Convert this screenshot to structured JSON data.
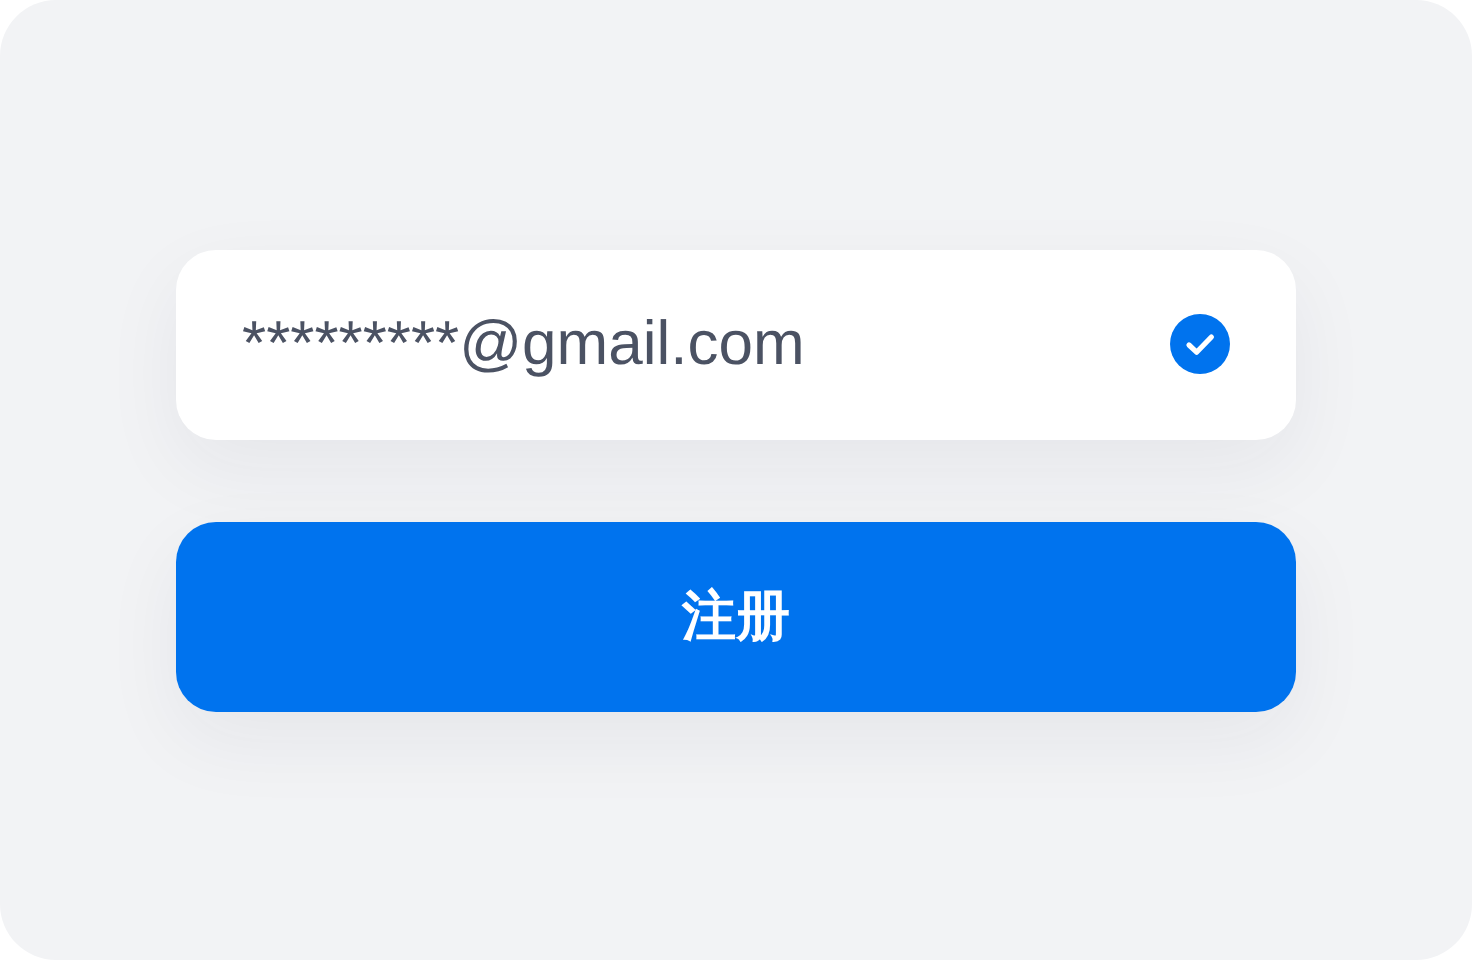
{
  "email_field": {
    "value": "*********@gmail.com",
    "valid": true
  },
  "submit_button": {
    "label": "注册"
  }
}
